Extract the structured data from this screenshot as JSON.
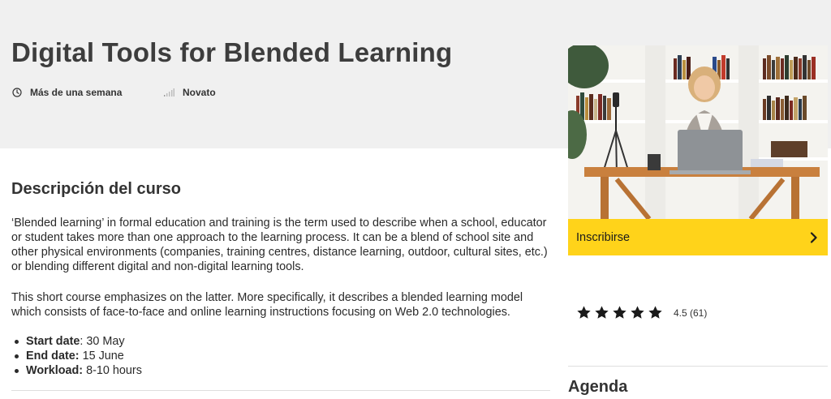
{
  "course": {
    "title": "Digital Tools for Blended Learning",
    "duration": "Más de una semana",
    "level": "Novato"
  },
  "description": {
    "heading": "Descripción del curso",
    "paragraphs": [
      "‘Blended learning’ in formal education and training is the term used to describe when a school, educator or student takes more than one approach to the learning process. It can be a blend of school site and other physical environments (companies, training centres, distance learning, outdoor, cultural sites, etc.) or blending different digital and non-digital learning tools.",
      "This short course emphasizes on the latter. More specifically, it describes a blended learning model which consists of face-to-face and online learning instructions focusing on Web 2.0 technologies."
    ],
    "details": [
      {
        "label": "Start date",
        "sep": ": ",
        "value": "30 May"
      },
      {
        "label": "End date:",
        "sep": " ",
        "value": "15 June"
      },
      {
        "label": "Workload:",
        "sep": " ",
        "value": "8-10 hours"
      }
    ]
  },
  "sidebar": {
    "enroll_label": "Inscribirse",
    "rating": {
      "value": 4.5,
      "stars": 5,
      "text": "4.5 (61)"
    },
    "agenda_heading": "Agenda"
  },
  "colors": {
    "accent": "#ffd31a",
    "hero_background": "#f0f0f0",
    "title": "#3d3d3d"
  },
  "icons": {
    "duration": "clock-icon",
    "level": "signal-bars-icon",
    "enroll": "chevron-right-icon",
    "rating": "star-icon"
  }
}
